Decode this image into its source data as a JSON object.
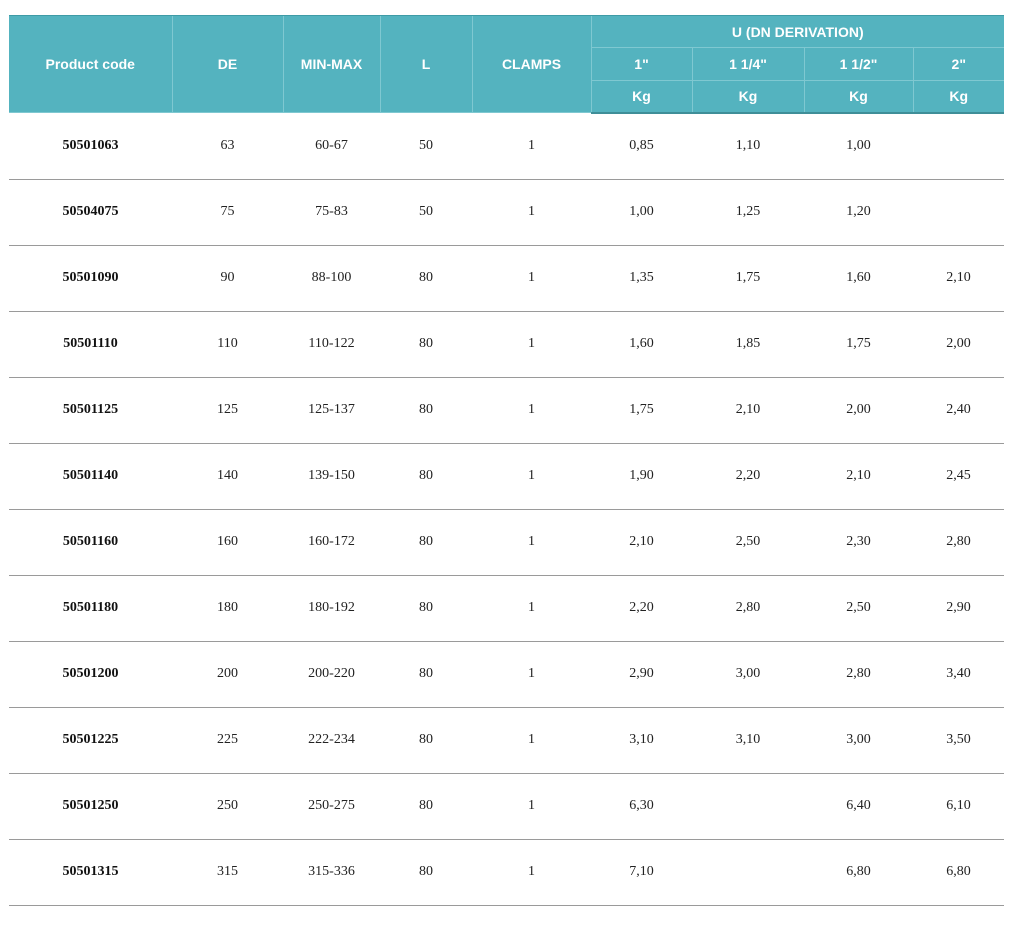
{
  "header": {
    "product_code": "Product code",
    "de": "DE",
    "min_max": "MIN-MAX",
    "l": "L",
    "clamps": "CLAMPS",
    "u_group": "U (DN DERIVATION)",
    "sizes": [
      "1\"",
      "1 1/4\"",
      "1 1/2\"",
      "2\""
    ],
    "units": [
      "Kg",
      "Kg",
      "Kg",
      "Kg"
    ]
  },
  "rows": [
    {
      "code": "50501063",
      "de": "63",
      "minmax": "60-67",
      "l": "50",
      "clamps": "1",
      "w1": "0,85",
      "w2": "1,10",
      "w3": "1,00",
      "w4": ""
    },
    {
      "code": "50504075",
      "de": "75",
      "minmax": "75-83",
      "l": "50",
      "clamps": "1",
      "w1": "1,00",
      "w2": "1,25",
      "w3": "1,20",
      "w4": ""
    },
    {
      "code": "50501090",
      "de": "90",
      "minmax": "88-100",
      "l": "80",
      "clamps": "1",
      "w1": "1,35",
      "w2": "1,75",
      "w3": "1,60",
      "w4": "2,10"
    },
    {
      "code": "50501110",
      "de": "110",
      "minmax": "110-122",
      "l": "80",
      "clamps": "1",
      "w1": "1,60",
      "w2": "1,85",
      "w3": "1,75",
      "w4": "2,00"
    },
    {
      "code": "50501125",
      "de": "125",
      "minmax": "125-137",
      "l": "80",
      "clamps": "1",
      "w1": "1,75",
      "w2": "2,10",
      "w3": "2,00",
      "w4": "2,40"
    },
    {
      "code": "50501140",
      "de": "140",
      "minmax": "139-150",
      "l": "80",
      "clamps": "1",
      "w1": "1,90",
      "w2": "2,20",
      "w3": "2,10",
      "w4": "2,45"
    },
    {
      "code": "50501160",
      "de": "160",
      "minmax": "160-172",
      "l": "80",
      "clamps": "1",
      "w1": "2,10",
      "w2": "2,50",
      "w3": "2,30",
      "w4": "2,80"
    },
    {
      "code": "50501180",
      "de": "180",
      "minmax": "180-192",
      "l": "80",
      "clamps": "1",
      "w1": "2,20",
      "w2": "2,80",
      "w3": "2,50",
      "w4": "2,90"
    },
    {
      "code": "50501200",
      "de": "200",
      "minmax": "200-220",
      "l": "80",
      "clamps": "1",
      "w1": "2,90",
      "w2": "3,00",
      "w3": "2,80",
      "w4": "3,40"
    },
    {
      "code": "50501225",
      "de": "225",
      "minmax": "222-234",
      "l": "80",
      "clamps": "1",
      "w1": "3,10",
      "w2": "3,10",
      "w3": "3,00",
      "w4": "3,50"
    },
    {
      "code": "50501250",
      "de": "250",
      "minmax": "250-275",
      "l": "80",
      "clamps": "1",
      "w1": "6,30",
      "w2": "",
      "w3": "6,40",
      "w4": "6,10"
    },
    {
      "code": "50501315",
      "de": "315",
      "minmax": "315-336",
      "l": "80",
      "clamps": "1",
      "w1": "7,10",
      "w2": "",
      "w3": "6,80",
      "w4": "6,80"
    }
  ],
  "colors": {
    "header_bg": "#54b3bf",
    "header_text": "#ffffff",
    "row_divider": "#9a9a9a"
  }
}
